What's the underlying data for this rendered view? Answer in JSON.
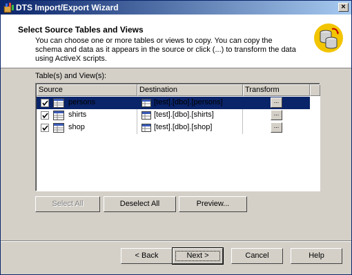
{
  "window": {
    "title": "DTS Import/Export Wizard",
    "close_label": "×"
  },
  "header": {
    "title": "Select Source Tables and Views",
    "description": "You can choose one or more tables or views to copy.  You can copy the schema and data as it appears in the source or click (...) to transform the data using ActiveX scripts."
  },
  "grid": {
    "label": "Table(s) and View(s):",
    "columns": [
      "Source",
      "Destination",
      "Transform"
    ],
    "rows": [
      {
        "source": "persons",
        "destination": "[test].[dbo].[persons]",
        "transform": "...",
        "checked": true,
        "selected": true
      },
      {
        "source": "shirts",
        "destination": "[test].[dbo].[shirts]",
        "transform": "...",
        "checked": true,
        "selected": false
      },
      {
        "source": "shop",
        "destination": "[test].[dbo].[shop]",
        "transform": "...",
        "checked": true,
        "selected": false
      }
    ]
  },
  "actions": {
    "select_all": "Select All",
    "deselect_all": "Deselect All",
    "preview": "Preview..."
  },
  "nav": {
    "back": "< Back",
    "next": "Next >",
    "cancel": "Cancel",
    "help": "Help"
  },
  "colors": {
    "title_start": "#0a246a",
    "title_end": "#a6caf0",
    "selection": "#0a246a",
    "face": "#d4d0c8"
  },
  "icons": {
    "app": "wizard-app-icon",
    "database": "database-copy-icon",
    "table": "table-icon",
    "checkbox": "checkmark-icon"
  }
}
